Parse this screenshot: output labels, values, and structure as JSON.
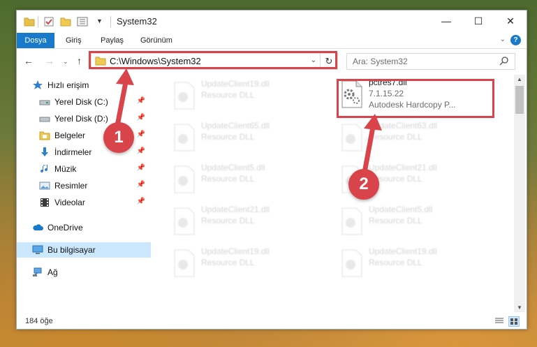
{
  "window": {
    "title": "System32"
  },
  "ribbon": {
    "tabs": [
      "Dosya",
      "Giriş",
      "Paylaş",
      "Görünüm"
    ],
    "help": "?"
  },
  "nav": {
    "address": "C:\\Windows\\System32",
    "search_placeholder": "Ara: System32"
  },
  "sidebar": {
    "items": [
      {
        "label": "Hızlı erişim",
        "icon": "star-icon"
      },
      {
        "label": "Yerel Disk (C:)",
        "icon": "drive-icon",
        "pinned": true
      },
      {
        "label": "Yerel Disk (D:)",
        "icon": "drive-icon",
        "pinned": true
      },
      {
        "label": "Belgeler",
        "icon": "documents-icon",
        "pinned": true
      },
      {
        "label": "İndirmeler",
        "icon": "download-icon",
        "pinned": true
      },
      {
        "label": "Müzik",
        "icon": "music-icon",
        "pinned": true
      },
      {
        "label": "Resimler",
        "icon": "pictures-icon",
        "pinned": true
      },
      {
        "label": "Videolar",
        "icon": "videos-icon",
        "pinned": true
      },
      {
        "label": "OneDrive",
        "icon": "cloud-icon"
      },
      {
        "label": "Bu bilgisayar",
        "icon": "computer-icon",
        "selected": true
      },
      {
        "label": "Ağ",
        "icon": "network-icon"
      }
    ]
  },
  "files": {
    "highlighted": {
      "name": "pctres7.dll",
      "version": "7.1.15.22",
      "description": "Autodesk Hardcopy P..."
    },
    "left_column": [
      {
        "name": "UpdateClient19.dll",
        "type": "Resource DLL"
      },
      {
        "name": "UpdateClient65.dll",
        "type": "Resource DLL"
      },
      {
        "name": "UpdateClient5.dll",
        "type": "Resource DLL"
      },
      {
        "name": "UpdateClient21.dll",
        "type": "Resource DLL"
      },
      {
        "name": "UpdateClient19.dll",
        "type": "Resource DLL"
      }
    ],
    "right_column": [
      {
        "name": "UpdateClient63.dll",
        "type": "Resource DLL"
      },
      {
        "name": "UpdateClient21.dll",
        "type": "Resource DLL"
      },
      {
        "name": "UpdateClient5.dll",
        "type": "Resource DLL"
      },
      {
        "name": "UpdateClient19.dll",
        "type": "Resource DLL"
      }
    ]
  },
  "status": {
    "count": "184 öğe"
  },
  "callouts": {
    "one": "1",
    "two": "2"
  },
  "colors": {
    "accent": "#1979ca",
    "highlight": "#d9434a",
    "selection": "#cce8ff"
  }
}
